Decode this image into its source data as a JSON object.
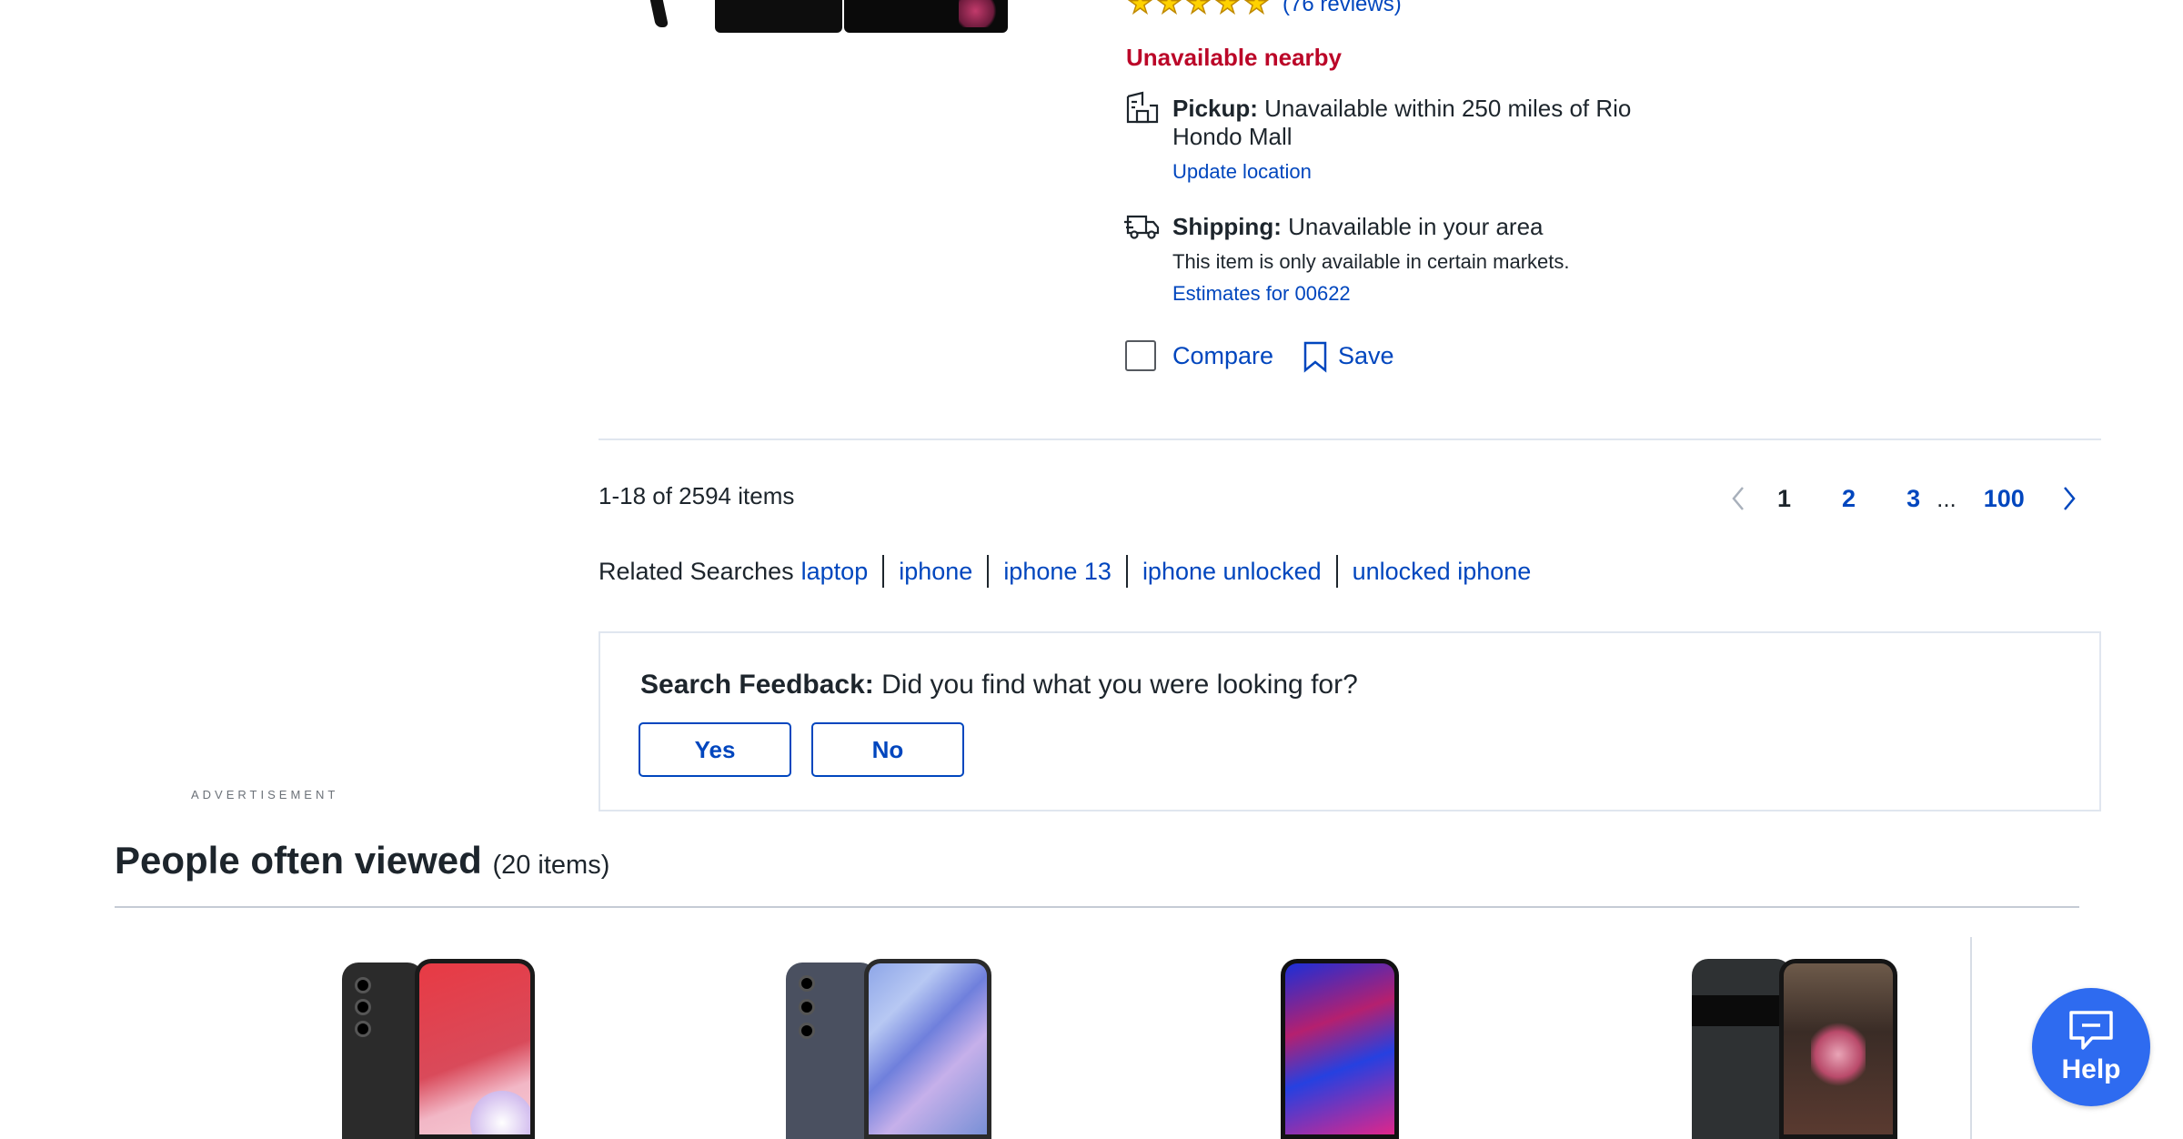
{
  "product": {
    "reviews_text": "(76 reviews)",
    "rating_stars": 5,
    "availability": "Unavailable nearby",
    "pickup_label": "Pickup:",
    "pickup_text": "Unavailable within 250 miles of Rio Hondo Mall",
    "update_location": "Update location",
    "shipping_label": "Shipping:",
    "shipping_text": "Unavailable in your area",
    "shipping_note": "This item is only available in certain markets.",
    "estimates_link": "Estimates for 00622",
    "compare_label": "Compare",
    "save_label": "Save"
  },
  "results": {
    "count_text": "1-18 of 2594 items"
  },
  "pagination": {
    "pages": [
      "1",
      "2",
      "3"
    ],
    "ellipsis": "...",
    "last_page": "100",
    "current": "1"
  },
  "related": {
    "label": "Related Searches",
    "links": [
      "laptop",
      "iphone",
      "iphone 13",
      "iphone unlocked",
      "unlocked iphone"
    ]
  },
  "feedback": {
    "label": "Search Feedback:",
    "question": "Did you find what you were looking for?",
    "yes": "Yes",
    "no": "No"
  },
  "advertisement_label": "ADVERTISEMENT",
  "people_viewed": {
    "title": "People often viewed",
    "count": "(20 items)"
  },
  "help": {
    "label": "Help"
  },
  "colors": {
    "link_blue": "#0046be",
    "alert_red": "#bb0628",
    "help_blue": "#2e6bf0",
    "star_yellow": "#ffd200"
  }
}
